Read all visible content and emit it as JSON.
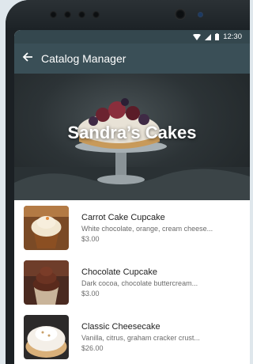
{
  "status_bar": {
    "time": "12:30"
  },
  "app_bar": {
    "title": "Catalog Manager",
    "back_icon": "arrow-left-icon"
  },
  "hero": {
    "title": "Sandra’s Cakes"
  },
  "items": [
    {
      "name": "Carrot Cake Cupcake",
      "description": "White chocolate, orange, cream cheese...",
      "price": "$3.00"
    },
    {
      "name": "Chocolate Cupcake",
      "description": "Dark cocoa, chocolate buttercream...",
      "price": "$3.00"
    },
    {
      "name": "Classic Cheesecake",
      "description": "Vanilla, citrus, graham cracker crust...",
      "price": "$26.00"
    }
  ]
}
